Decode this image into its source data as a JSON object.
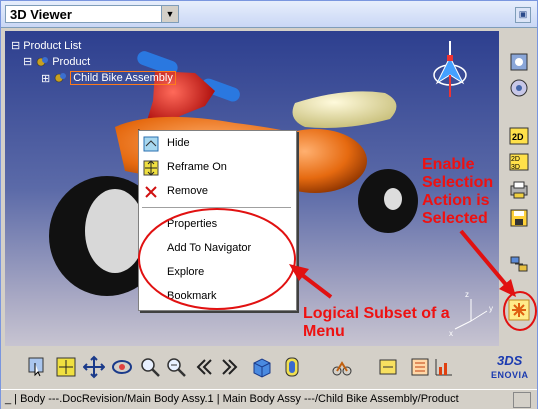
{
  "window": {
    "title": "3D Viewer",
    "restore_glyph": "▣"
  },
  "tree": {
    "root": "Product List",
    "product": "Product",
    "child": "Child Bike Assembly",
    "expand_glyph": "⊞",
    "collapse_glyph": "⊟"
  },
  "context_menu": {
    "items": [
      {
        "label": "Hide",
        "icon": "hide-icon"
      },
      {
        "label": "Reframe On",
        "icon": "reframe-icon"
      },
      {
        "label": "Remove",
        "icon": "remove-x-icon"
      },
      {
        "label": "Properties"
      },
      {
        "label": "Add To Navigator"
      },
      {
        "label": "Explore"
      },
      {
        "label": "Bookmark"
      }
    ]
  },
  "annotations": {
    "enable_selection": "Enable Selection Action is Selected",
    "logical_subset": "Logical Subset of a Menu"
  },
  "right_toolbar": [
    "view-orient-icon",
    "rotate-icon",
    "2d-icon",
    "2d-split-icon",
    "print-icon",
    "save-icon",
    "arrange-icon",
    "selection-action-icon"
  ],
  "bottom_toolbar": [
    "select-icon",
    "fit-all-icon",
    "pan-icon",
    "rotate-view-icon",
    "zoom-in-icon",
    "zoom-out-icon",
    "previous-view-icon",
    "next-view-icon",
    "iso-view-icon",
    "render-icon",
    "bike-icon",
    "compass-icon",
    "tree-toggle-icon",
    "enovia-logo"
  ],
  "logo": {
    "brand": "ENOVIA",
    "mark": "3DS"
  },
  "status": {
    "text": "_ | Body ---.DocRevision/Main Body Assy.1 | Main Body Assy ---/Child Bike Assembly/Product"
  },
  "colors": {
    "annotation": "#e11111",
    "selection_border": "#ff7a1a"
  }
}
